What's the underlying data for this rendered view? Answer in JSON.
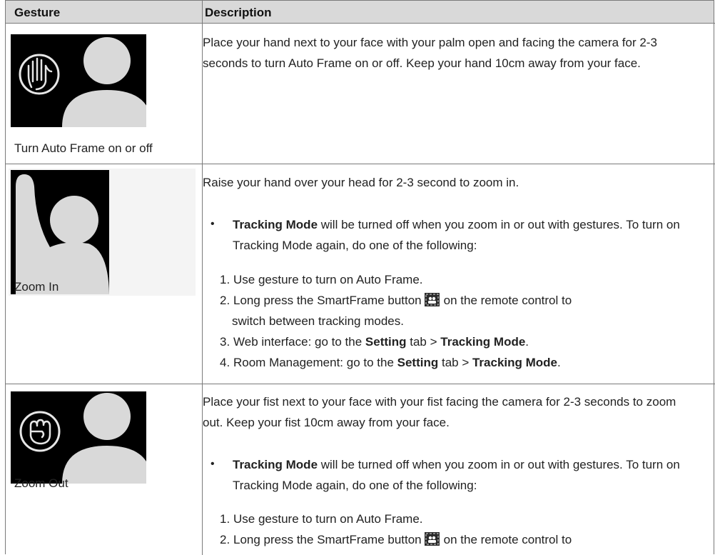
{
  "headers": {
    "gesture": "Gesture",
    "description": "Description"
  },
  "rows": [
    {
      "caption": "Turn Auto Frame on or off",
      "text": "Place your hand next to your face with your palm open and facing the camera for 2-3 seconds to turn Auto Frame on or off. Keep your hand 10cm away from your face."
    },
    {
      "caption": "Zoom In",
      "text": "Raise your hand over your head for 2-3 second to zoom in.",
      "bullet_bold": "Tracking Mode",
      "bullet_rest": " will be turned off when you zoom in or out with gestures. To turn on Tracking Mode again, do one of the following:",
      "steps": {
        "s1_num": "1.",
        "s1": "Use gesture to turn on Auto Frame.",
        "s2_num": "2.",
        "s2_pre": "Long press the SmartFrame button",
        "s2_post": "on the remote control to",
        "s2_cont": "switch between tracking modes.",
        "s3_num": "3.",
        "s3_pre": "Web interface: go to the ",
        "s3_b1": "Setting",
        "s3_mid": " tab > ",
        "s3_b2": "Tracking Mode",
        "s3_end": ".",
        "s4_num": "4.",
        "s4_pre": "Room Management: go to the ",
        "s4_b1": "Setting",
        "s4_mid": " tab > ",
        "s4_b2": "Tracking Mode",
        "s4_end": "."
      }
    },
    {
      "caption": "Zoom Out",
      "text": "Place your fist next to your face with your fist facing the camera for 2-3 seconds to zoom out. Keep your fist 10cm away from your face.",
      "bullet_bold": "Tracking Mode",
      "bullet_rest": " will be turned off when you zoom in or out with gestures. To turn on Tracking Mode again, do one of the following:",
      "steps": {
        "s1_num": "1.",
        "s1": "Use gesture to turn on Auto Frame.",
        "s2_num": "2.",
        "s2_pre": "Long press the SmartFrame button",
        "s2_post": "on the remote control to"
      }
    }
  ],
  "bullet_symbol": "•",
  "icons": [
    "open-palm-gesture-icon",
    "raised-hand-gesture-icon",
    "fist-gesture-icon",
    "smartframe-button-icon"
  ]
}
